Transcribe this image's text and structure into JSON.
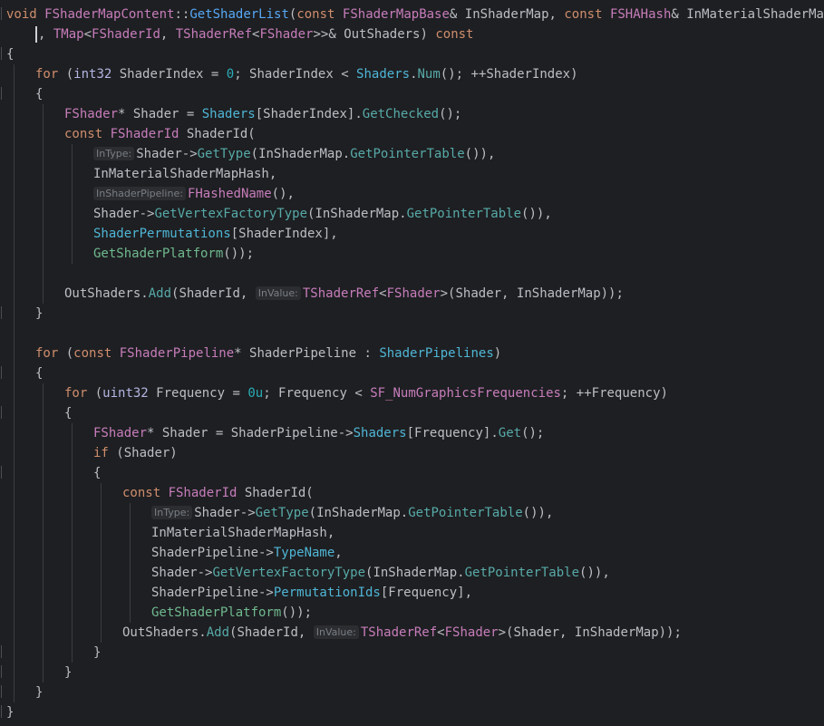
{
  "editor": {
    "background": "#1e1f22",
    "lines": [
      {
        "indent": 0,
        "tokens": [
          [
            "kw",
            "void "
          ],
          [
            "tcls",
            "FShaderMapContent"
          ],
          [
            "op",
            "::"
          ],
          [
            "fn",
            "GetShaderList"
          ],
          [
            "op",
            "("
          ],
          [
            "kw",
            "const "
          ],
          [
            "tcls",
            "FShaderMapBase"
          ],
          [
            "op",
            "& InShaderMap, "
          ],
          [
            "kw",
            "const "
          ],
          [
            "tcls",
            "FSHAHash"
          ],
          [
            "op",
            "& InMaterialShaderMapHash"
          ]
        ]
      },
      {
        "indent": 1,
        "caret": true,
        "tokens": [
          [
            "op",
            ", "
          ],
          [
            "tcls",
            "TMap"
          ],
          [
            "op",
            "<"
          ],
          [
            "tcls",
            "FShaderId"
          ],
          [
            "op",
            ", "
          ],
          [
            "tcls",
            "TShaderRef"
          ],
          [
            "op",
            "<"
          ],
          [
            "tcls",
            "FShader"
          ],
          [
            "op",
            ">>& OutShaders) "
          ],
          [
            "kw",
            "const"
          ]
        ]
      },
      {
        "indent": 0,
        "tokens": [
          [
            "op",
            "{"
          ]
        ]
      },
      {
        "indent": 1,
        "tokens": [
          [
            "kw",
            "for "
          ],
          [
            "op",
            "("
          ],
          [
            "type",
            "int32 "
          ],
          [
            "op",
            "ShaderIndex = "
          ],
          [
            "num",
            "0"
          ],
          [
            "op",
            "; ShaderIndex < "
          ],
          [
            "prop",
            "Shaders"
          ],
          [
            "op",
            "."
          ],
          [
            "mfn",
            "Num"
          ],
          [
            "op",
            "(); ++ShaderIndex)"
          ]
        ]
      },
      {
        "indent": 1,
        "tokens": [
          [
            "op",
            "{"
          ]
        ]
      },
      {
        "indent": 2,
        "tokens": [
          [
            "tcls",
            "FShader"
          ],
          [
            "op",
            "* Shader = "
          ],
          [
            "prop",
            "Shaders"
          ],
          [
            "op",
            "[ShaderIndex]."
          ],
          [
            "mfn",
            "GetChecked"
          ],
          [
            "op",
            "();"
          ]
        ]
      },
      {
        "indent": 2,
        "tokens": [
          [
            "kw",
            "const "
          ],
          [
            "tcls",
            "FShaderId "
          ],
          [
            "op",
            "ShaderId("
          ]
        ]
      },
      {
        "indent": 3,
        "tokens": [
          [
            "hint",
            "InType:"
          ],
          [
            "op",
            "Shader->"
          ],
          [
            "mfn",
            "GetType"
          ],
          [
            "op",
            "(InShaderMap."
          ],
          [
            "mfn",
            "GetPointerTable"
          ],
          [
            "op",
            "()),"
          ]
        ]
      },
      {
        "indent": 3,
        "tokens": [
          [
            "op",
            "InMaterialShaderMapHash,"
          ]
        ]
      },
      {
        "indent": 3,
        "tokens": [
          [
            "hint",
            "InShaderPipeline:"
          ],
          [
            "tcls",
            "FHashedName"
          ],
          [
            "op",
            "(),"
          ]
        ]
      },
      {
        "indent": 3,
        "tokens": [
          [
            "op",
            "Shader->"
          ],
          [
            "mfn",
            "GetVertexFactoryType"
          ],
          [
            "op",
            "(InShaderMap."
          ],
          [
            "mfn",
            "GetPointerTable"
          ],
          [
            "op",
            "()),"
          ]
        ]
      },
      {
        "indent": 3,
        "tokens": [
          [
            "prop",
            "ShaderPermutations"
          ],
          [
            "op",
            "[ShaderIndex],"
          ]
        ]
      },
      {
        "indent": 3,
        "tokens": [
          [
            "cfn",
            "GetShaderPlatform"
          ],
          [
            "op",
            "());"
          ]
        ]
      },
      {
        "indent": 0,
        "tokens": []
      },
      {
        "indent": 2,
        "tokens": [
          [
            "op",
            "OutShaders."
          ],
          [
            "mfn",
            "Add"
          ],
          [
            "op",
            "(ShaderId, "
          ],
          [
            "hint",
            "InValue:"
          ],
          [
            "tcls",
            "TShaderRef"
          ],
          [
            "op",
            "<"
          ],
          [
            "tcls",
            "FShader"
          ],
          [
            "op",
            ">(Shader, InShaderMap));"
          ]
        ]
      },
      {
        "indent": 1,
        "tokens": [
          [
            "op",
            "}"
          ]
        ]
      },
      {
        "indent": 0,
        "tokens": []
      },
      {
        "indent": 1,
        "tokens": [
          [
            "kw",
            "for "
          ],
          [
            "op",
            "("
          ],
          [
            "kw",
            "const "
          ],
          [
            "tcls",
            "FShaderPipeline"
          ],
          [
            "op",
            "* ShaderPipeline : "
          ],
          [
            "prop",
            "ShaderPipelines"
          ],
          [
            "op",
            ")"
          ]
        ]
      },
      {
        "indent": 1,
        "tokens": [
          [
            "op",
            "{"
          ]
        ]
      },
      {
        "indent": 2,
        "tokens": [
          [
            "kw",
            "for "
          ],
          [
            "op",
            "("
          ],
          [
            "type",
            "uint32 "
          ],
          [
            "op",
            "Frequency = "
          ],
          [
            "num",
            "0u"
          ],
          [
            "op",
            "; Frequency < "
          ],
          [
            "tcls",
            "SF_NumGraphicsFrequencies"
          ],
          [
            "op",
            "; ++Frequency)"
          ]
        ]
      },
      {
        "indent": 2,
        "tokens": [
          [
            "op",
            "{"
          ]
        ]
      },
      {
        "indent": 3,
        "tokens": [
          [
            "tcls",
            "FShader"
          ],
          [
            "op",
            "* Shader = ShaderPipeline->"
          ],
          [
            "prop",
            "Shaders"
          ],
          [
            "op",
            "[Frequency]."
          ],
          [
            "mfn",
            "Get"
          ],
          [
            "op",
            "();"
          ]
        ]
      },
      {
        "indent": 3,
        "tokens": [
          [
            "kw",
            "if "
          ],
          [
            "op",
            "(Shader)"
          ]
        ]
      },
      {
        "indent": 3,
        "tokens": [
          [
            "op",
            "{"
          ]
        ]
      },
      {
        "indent": 4,
        "tokens": [
          [
            "kw",
            "const "
          ],
          [
            "tcls",
            "FShaderId "
          ],
          [
            "op",
            "ShaderId("
          ]
        ]
      },
      {
        "indent": 5,
        "tokens": [
          [
            "hint",
            "InType:"
          ],
          [
            "op",
            "Shader->"
          ],
          [
            "mfn",
            "GetType"
          ],
          [
            "op",
            "(InShaderMap."
          ],
          [
            "mfn",
            "GetPointerTable"
          ],
          [
            "op",
            "()),"
          ]
        ]
      },
      {
        "indent": 5,
        "tokens": [
          [
            "op",
            "InMaterialShaderMapHash,"
          ]
        ]
      },
      {
        "indent": 5,
        "tokens": [
          [
            "op",
            "ShaderPipeline->"
          ],
          [
            "prop",
            "TypeName"
          ],
          [
            "op",
            ","
          ]
        ]
      },
      {
        "indent": 5,
        "tokens": [
          [
            "op",
            "Shader->"
          ],
          [
            "mfn",
            "GetVertexFactoryType"
          ],
          [
            "op",
            "(InShaderMap."
          ],
          [
            "mfn",
            "GetPointerTable"
          ],
          [
            "op",
            "()),"
          ]
        ]
      },
      {
        "indent": 5,
        "tokens": [
          [
            "op",
            "ShaderPipeline->"
          ],
          [
            "prop",
            "PermutationIds"
          ],
          [
            "op",
            "[Frequency],"
          ]
        ]
      },
      {
        "indent": 5,
        "tokens": [
          [
            "cfn",
            "GetShaderPlatform"
          ],
          [
            "op",
            "());"
          ]
        ]
      },
      {
        "indent": 4,
        "tokens": [
          [
            "op",
            "OutShaders."
          ],
          [
            "mfn",
            "Add"
          ],
          [
            "op",
            "(ShaderId, "
          ],
          [
            "hint",
            "InValue:"
          ],
          [
            "tcls",
            "TShaderRef"
          ],
          [
            "op",
            "<"
          ],
          [
            "tcls",
            "FShader"
          ],
          [
            "op",
            ">(Shader, InShaderMap));"
          ]
        ]
      },
      {
        "indent": 3,
        "tokens": [
          [
            "op",
            "}"
          ]
        ]
      },
      {
        "indent": 2,
        "tokens": [
          [
            "op",
            "}"
          ]
        ]
      },
      {
        "indent": 1,
        "tokens": [
          [
            "op",
            "}"
          ]
        ]
      },
      {
        "indent": 0,
        "tokens": [
          [
            "op",
            "}"
          ]
        ]
      }
    ]
  },
  "colors": {
    "keyword": "#cf8e6d",
    "class": "#c77dbb",
    "function": "#56a8f5",
    "method": "#57aaa8",
    "field": "#4fb6d6",
    "number": "#2aacb8",
    "text": "#bcbec4",
    "hint_text": "#7a7e85",
    "hint_background": "#2b2d30"
  }
}
